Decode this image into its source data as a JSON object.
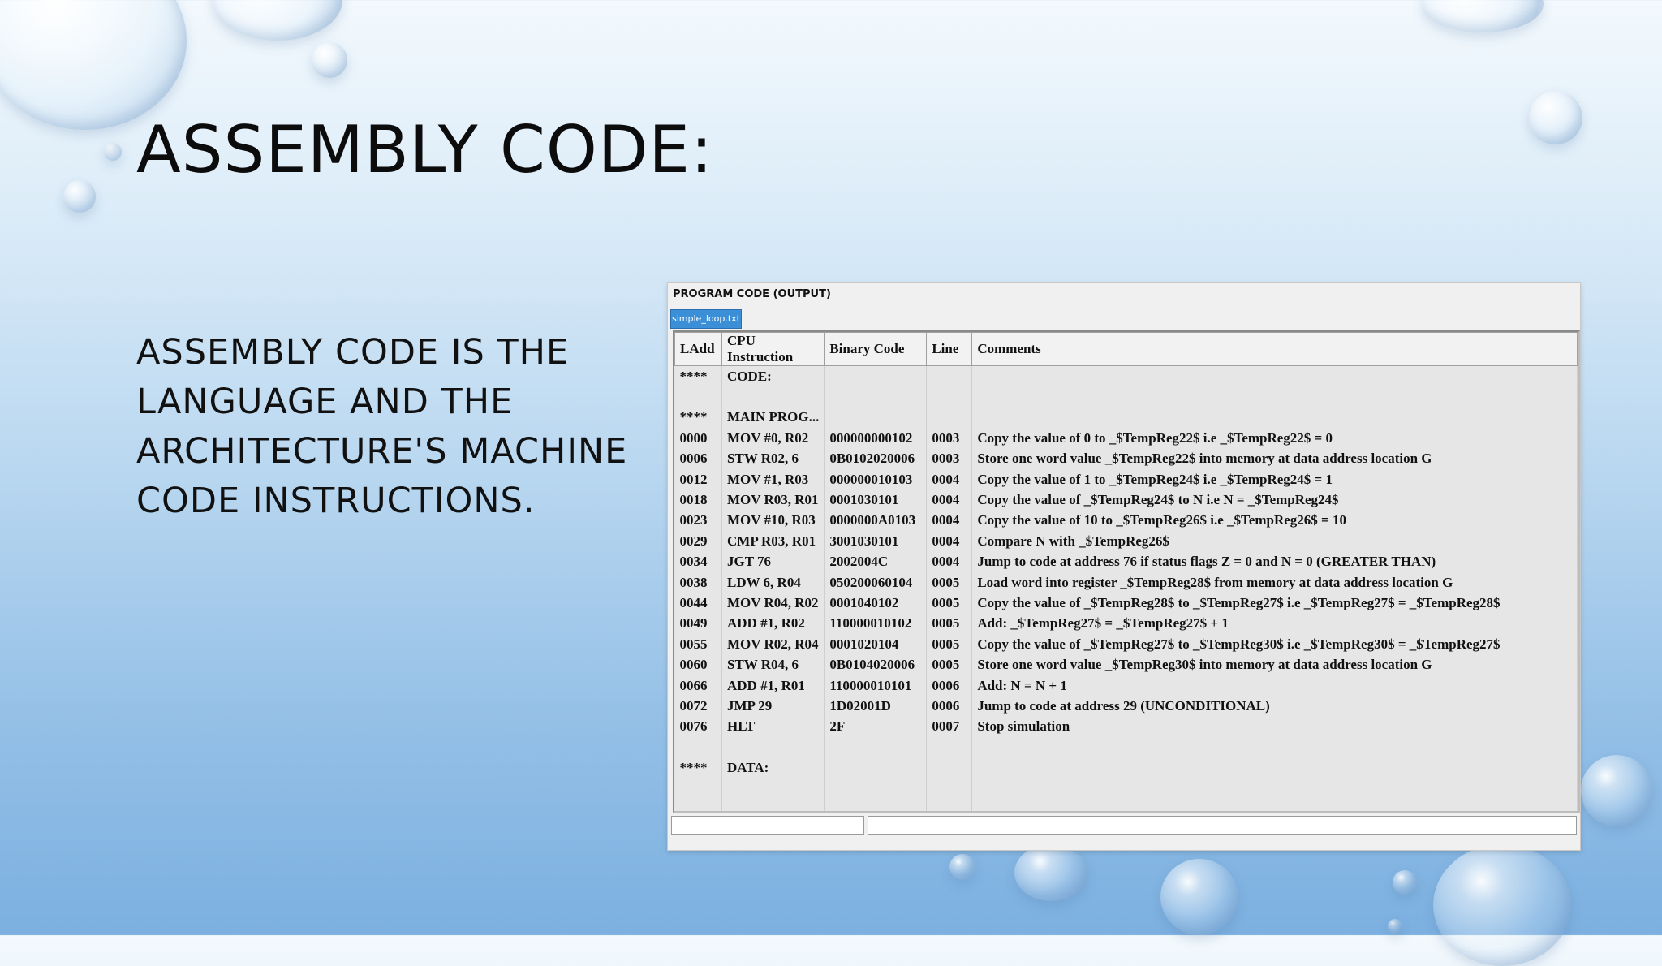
{
  "slide": {
    "title": "ASSEMBLY CODE:",
    "body_lines": [
      "ASSEMBLY CODE IS THE",
      "LANGUAGE AND THE",
      "ARCHITECTURE'S MACHINE",
      "CODE INSTRUCTIONS."
    ]
  },
  "window": {
    "title": "PROGRAM CODE (OUTPUT)",
    "tab_label": "simple_loop.txt",
    "columns": [
      "LAdd",
      "CPU Instruction",
      "Binary Code",
      "Line",
      "Comments"
    ],
    "rows": [
      [
        "****",
        "CODE:",
        "",
        "",
        ""
      ],
      [
        "",
        "",
        "",
        "",
        ""
      ],
      [
        "****",
        "MAIN PROG...",
        "",
        "",
        ""
      ],
      [
        "0000",
        "MOV #0, R02",
        "000000000102",
        "0003",
        "Copy the value of  0 to _$TempReg22$ i.e _$TempReg22$ =  0"
      ],
      [
        "0006",
        "STW R02, 6",
        "0B0102020006",
        "0003",
        "Store one word value _$TempReg22$ into memory at data address location G"
      ],
      [
        "0012",
        "MOV #1, R03",
        "000000010103",
        "0004",
        "Copy the value of  1 to _$TempReg24$ i.e _$TempReg24$ =  1"
      ],
      [
        "0018",
        "MOV R03, R01",
        "0001030101",
        "0004",
        "Copy the value of _$TempReg24$ to N i.e N = _$TempReg24$"
      ],
      [
        "0023",
        "MOV #10, R03",
        "0000000A0103",
        "0004",
        "Copy the value of  10 to _$TempReg26$ i.e _$TempReg26$ =  10"
      ],
      [
        "0029",
        "CMP R03, R01",
        "3001030101",
        "0004",
        "Compare N with _$TempReg26$"
      ],
      [
        "0034",
        "JGT 76",
        "2002004C",
        "0004",
        "Jump to code at address 76 if status flags Z = 0 and N = 0 (GREATER THAN)"
      ],
      [
        "0038",
        "LDW 6, R04",
        "050200060104",
        "0005",
        "Load word into register _$TempReg28$ from memory at data address location G"
      ],
      [
        "0044",
        "MOV R04, R02",
        "0001040102",
        "0005",
        "Copy the value of _$TempReg28$ to _$TempReg27$ i.e _$TempReg27$ = _$TempReg28$"
      ],
      [
        "0049",
        "ADD #1, R02",
        "110000010102",
        "0005",
        "Add: _$TempReg27$ = _$TempReg27$ +  1"
      ],
      [
        "0055",
        "MOV R02, R04",
        "0001020104",
        "0005",
        "Copy the value of _$TempReg27$ to _$TempReg30$ i.e _$TempReg30$ = _$TempReg27$"
      ],
      [
        "0060",
        "STW R04, 6",
        "0B0104020006",
        "0005",
        "Store one word value _$TempReg30$ into memory at data address location G"
      ],
      [
        "0066",
        "ADD #1, R01",
        "110000010101",
        "0006",
        "Add: N = N +  1"
      ],
      [
        "0072",
        "JMP 29",
        "1D02001D",
        "0006",
        "Jump to code at address  29 (UNCONDITIONAL)"
      ],
      [
        "0076",
        "HLT",
        "2F",
        "0007",
        "Stop simulation"
      ],
      [
        "",
        "",
        "",
        "",
        ""
      ],
      [
        "****",
        "DATA:",
        "",
        "",
        ""
      ],
      [
        "",
        "",
        "",
        "",
        ""
      ],
      [
        "",
        "",
        "",
        "",
        ""
      ]
    ]
  }
}
